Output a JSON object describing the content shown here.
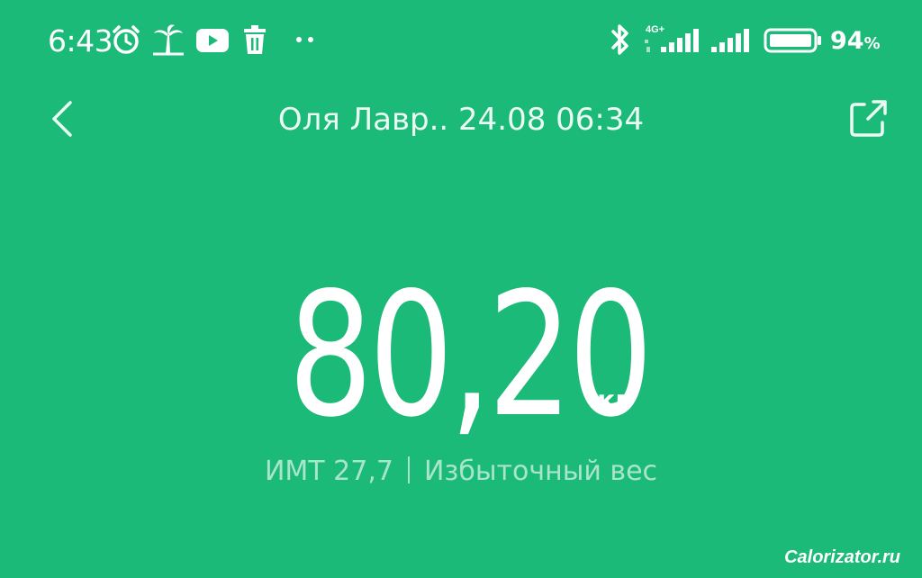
{
  "status_bar": {
    "time": "6:43",
    "network_label": "4G+",
    "battery_percent": "94",
    "battery_percent_sign": "%",
    "icons": [
      "alarm-icon",
      "palm-tree-icon",
      "youtube-icon",
      "trash-icon",
      "more-dots-icon",
      "bluetooth-icon",
      "signal-icon",
      "battery-icon"
    ]
  },
  "header": {
    "title": "Оля Лавр.. 24.08 06:34",
    "back_icon": "chevron-left-icon",
    "share_icon": "share-icon"
  },
  "measurement": {
    "weight": "80,20",
    "unit": "кг",
    "bmi_label": "ИМТ 27,7",
    "bmi_status": "Избыточный вес"
  },
  "watermark": "Calorizator.ru",
  "colors": {
    "background": "#1cba78",
    "text": "#ffffff"
  }
}
